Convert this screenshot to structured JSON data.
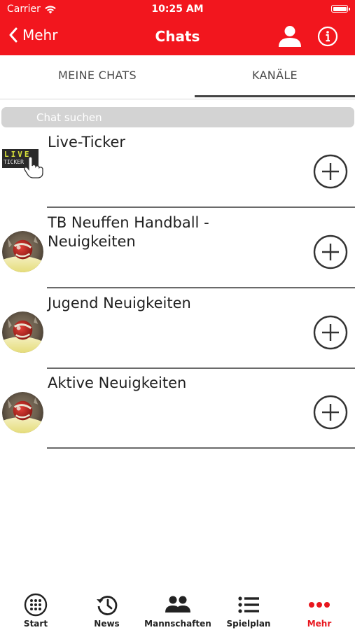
{
  "status_bar": {
    "carrier": "Carrier",
    "time": "10:25 AM"
  },
  "nav": {
    "back_label": "Mehr",
    "title": "Chats"
  },
  "tabs": [
    {
      "label": "MEINE CHATS",
      "selected": false
    },
    {
      "label": "KANÄLE",
      "selected": true
    }
  ],
  "search": {
    "placeholder": "Chat suchen",
    "value": ""
  },
  "ticker_thumb": {
    "line1": "LIVE",
    "line2": "TICKER"
  },
  "chats": [
    {
      "title": "Live-Ticker",
      "thumbnail": "live-ticker-image"
    },
    {
      "title": "TB Neuffen Handball - Neuigkeiten",
      "thumbnail": "handball-image"
    },
    {
      "title": "Jugend Neuigkeiten",
      "thumbnail": "handball-image"
    },
    {
      "title": "Aktive Neuigkeiten",
      "thumbnail": "handball-image"
    }
  ],
  "tabbar": [
    {
      "label": "Start",
      "icon": "dial-icon",
      "active": false
    },
    {
      "label": "News",
      "icon": "history-icon",
      "active": false
    },
    {
      "label": "Mannschaften",
      "icon": "people-icon",
      "active": false
    },
    {
      "label": "Spielplan",
      "icon": "list-icon",
      "active": false
    },
    {
      "label": "Mehr",
      "icon": "more-dots-icon",
      "active": true
    }
  ],
  "colors": {
    "header": "#f2161e",
    "accent_active": "#e8161e",
    "search_bg": "#d3d3d3"
  }
}
